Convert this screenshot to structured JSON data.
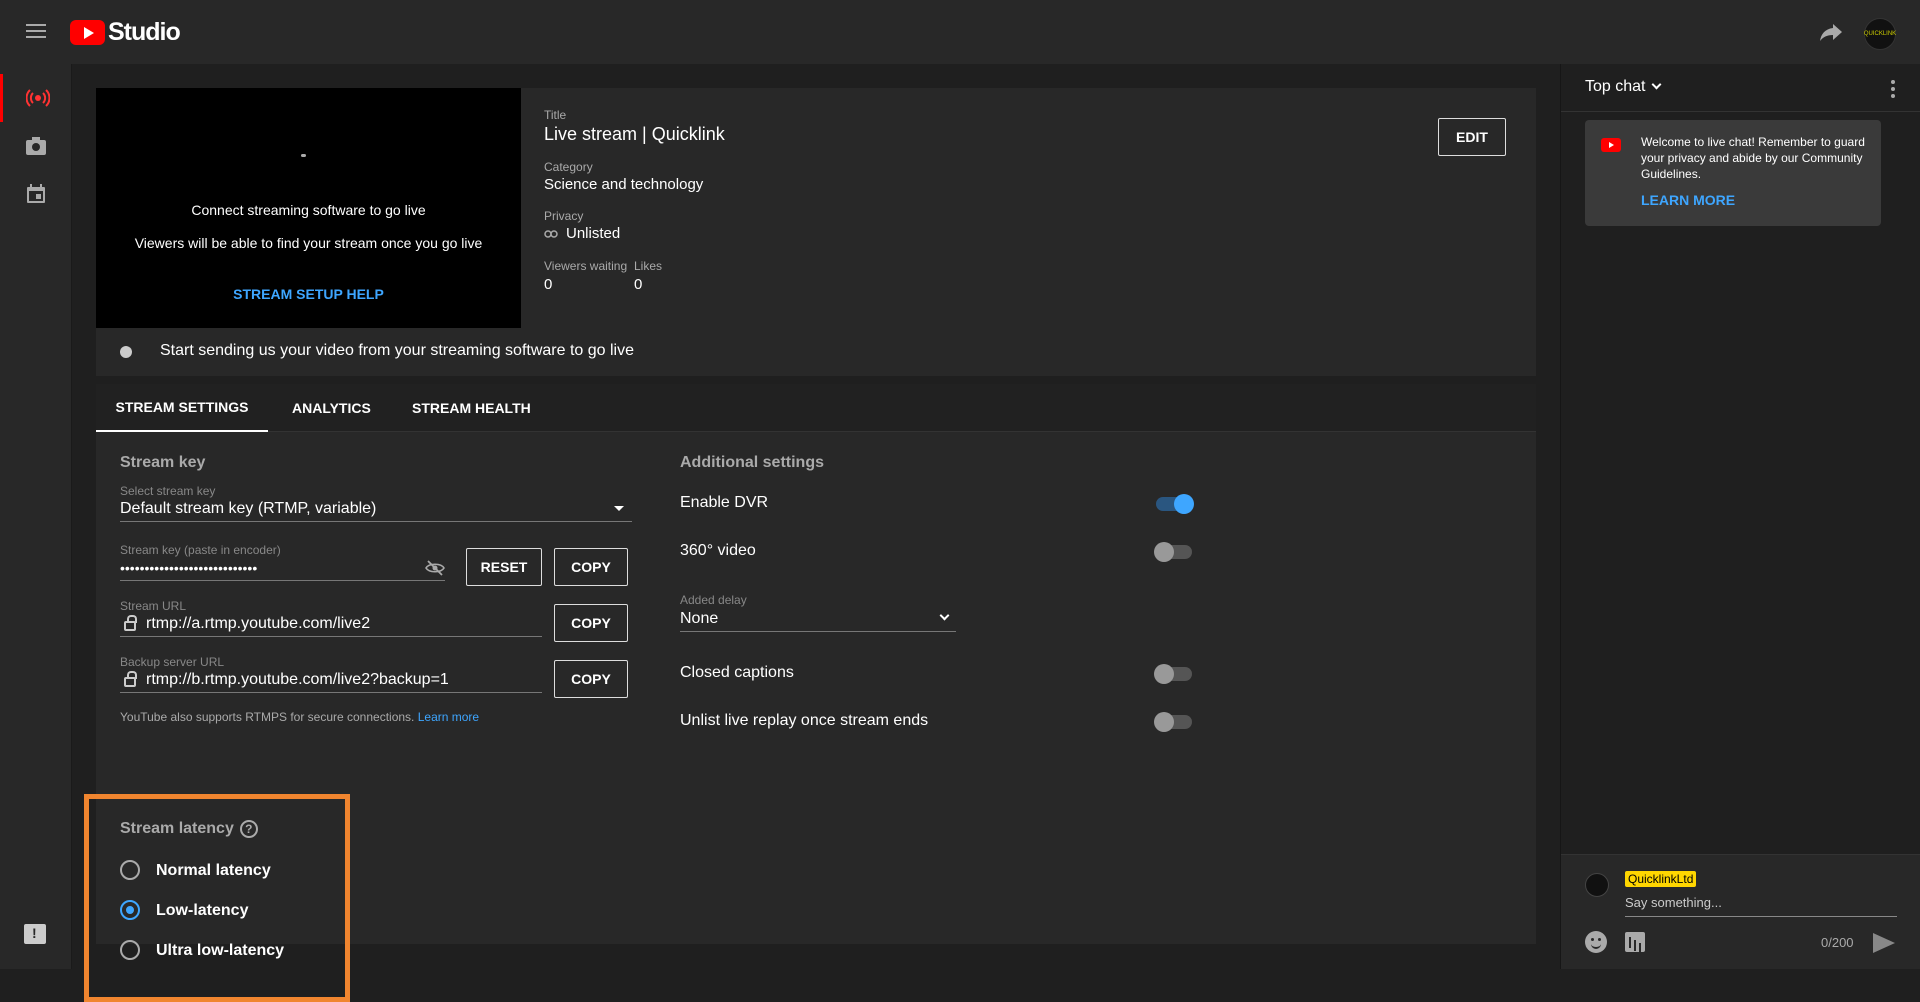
{
  "header": {
    "app_name": "Studio",
    "channel_logo_text": "QUICKLINK"
  },
  "preview": {
    "line1": "Connect streaming software to go live",
    "line2": "Viewers will be able to find your stream once you go live",
    "help_link": "STREAM SETUP HELP"
  },
  "details": {
    "title_label": "Title",
    "title_value": "Live stream | Quicklink",
    "category_label": "Category",
    "category_value": "Science and technology",
    "privacy_label": "Privacy",
    "privacy_value": "Unlisted",
    "viewers_label": "Viewers waiting",
    "viewers_value": "0",
    "likes_label": "Likes",
    "likes_value": "0",
    "edit_label": "EDIT"
  },
  "status": {
    "message": "Start sending us your video from your streaming software to go live"
  },
  "tabs": [
    {
      "label": "STREAM SETTINGS"
    },
    {
      "label": "ANALYTICS"
    },
    {
      "label": "STREAM HEALTH"
    }
  ],
  "stream_key": {
    "section_title": "Stream key",
    "select_label": "Select stream key",
    "select_value": "Default stream key (RTMP, variable)",
    "key_label": "Stream key (paste in encoder)",
    "key_value": "••••••••••••••••••••••••••••",
    "reset_label": "RESET",
    "copy_label": "COPY",
    "url_label": "Stream URL",
    "url_value": "rtmp://a.rtmp.youtube.com/live2",
    "backup_label": "Backup server URL",
    "backup_value": "rtmp://b.rtmp.youtube.com/live2?backup=1",
    "note": "YouTube also supports RTMPS for secure connections.",
    "note_link": "Learn more"
  },
  "latency": {
    "title": "Stream latency",
    "help_glyph": "?",
    "options": [
      {
        "label": "Normal latency",
        "selected": false
      },
      {
        "label": "Low-latency",
        "selected": true
      },
      {
        "label": "Ultra low-latency",
        "selected": false
      }
    ]
  },
  "additional": {
    "title": "Additional settings",
    "dvr_label": "Enable DVR",
    "dvr_on": true,
    "video360_label": "360° video",
    "video360_on": false,
    "delay_label": "Added delay",
    "delay_value": "None",
    "captions_label": "Closed captions",
    "captions_on": false,
    "unlist_label": "Unlist live replay once stream ends",
    "unlist_on": false
  },
  "chat": {
    "header": "Top chat",
    "welcome_text": "Welcome to live chat! Remember to guard your privacy and abide by our Community Guidelines.",
    "learn_more": "LEARN MORE",
    "user_name": "QuicklinkLtd",
    "placeholder": "Say something...",
    "counter": "0/200"
  },
  "colors": {
    "accent_blue": "#3ea6ff",
    "brand_red": "#ff0000",
    "highlight_orange": "#f0852f",
    "name_badge": "#ffd600"
  }
}
